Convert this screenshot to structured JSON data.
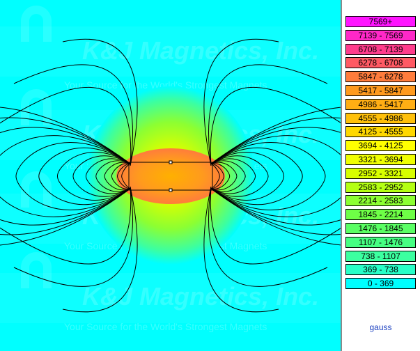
{
  "watermark": {
    "company": "K&J Magnetics, Inc.",
    "tagline": "Your Source for the World's Strongest Magnets"
  },
  "legend": {
    "items": [
      {
        "label": "7569+",
        "color": "#ff14ff"
      },
      {
        "label": "7139 - 7569",
        "color": "#ff28c8"
      },
      {
        "label": "6708 - 7139",
        "color": "#ff3c8c"
      },
      {
        "label": "6278 - 6708",
        "color": "#ff5a64"
      },
      {
        "label": "5847 - 6278",
        "color": "#ff7c3c"
      },
      {
        "label": "5417 - 5847",
        "color": "#ff9a1e"
      },
      {
        "label": "4986 - 5417",
        "color": "#ffae14"
      },
      {
        "label": "4555 - 4986",
        "color": "#ffc00a"
      },
      {
        "label": "4125 - 4555",
        "color": "#ffd800"
      },
      {
        "label": "3694 - 4125",
        "color": "#ffff00"
      },
      {
        "label": "3321 - 3694",
        "color": "#f0ff00"
      },
      {
        "label": "2952 - 3321",
        "color": "#d8ff00"
      },
      {
        "label": "2583 - 2952",
        "color": "#b4ff14"
      },
      {
        "label": "2214 - 2583",
        "color": "#8cff32"
      },
      {
        "label": "1845 - 2214",
        "color": "#6eff46"
      },
      {
        "label": "1476 - 1845",
        "color": "#5aff64"
      },
      {
        "label": "1107 - 1476",
        "color": "#46ff82"
      },
      {
        "label": "738 - 1107",
        "color": "#3cffa0"
      },
      {
        "label": "369 - 738",
        "color": "#28ffc8"
      },
      {
        "label": "0 - 369",
        "color": "#00ffff"
      }
    ],
    "unit": "gauss"
  },
  "colors": {
    "background": "#00ffff",
    "field_line": "#000000",
    "magnet_outline": "#000000"
  }
}
